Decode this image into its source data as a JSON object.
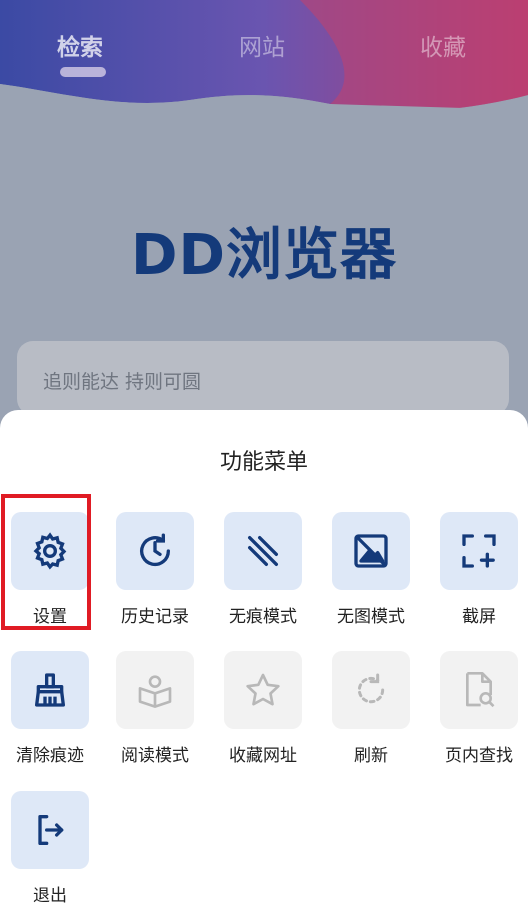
{
  "header": {
    "tabs": [
      {
        "label": "检索"
      },
      {
        "label": "网站"
      },
      {
        "label": "收藏"
      }
    ]
  },
  "main": {
    "title": "DD浏览器",
    "search_placeholder": "追则能达 持则可圆"
  },
  "menu": {
    "title": "功能菜单",
    "items": [
      {
        "label": "设置",
        "icon": "gear-icon",
        "enabled": true
      },
      {
        "label": "历史记录",
        "icon": "history-icon",
        "enabled": true
      },
      {
        "label": "无痕模式",
        "icon": "incognito-icon",
        "enabled": true
      },
      {
        "label": "无图模式",
        "icon": "no-image-icon",
        "enabled": true
      },
      {
        "label": "截屏",
        "icon": "screenshot-icon",
        "enabled": true
      },
      {
        "label": "清除痕迹",
        "icon": "broom-icon",
        "enabled": true
      },
      {
        "label": "阅读模式",
        "icon": "reader-icon",
        "enabled": false
      },
      {
        "label": "收藏网址",
        "icon": "star-icon",
        "enabled": false
      },
      {
        "label": "刷新",
        "icon": "refresh-icon",
        "enabled": false
      },
      {
        "label": "页内查找",
        "icon": "find-in-page-icon",
        "enabled": false
      },
      {
        "label": "退出",
        "icon": "exit-icon",
        "enabled": true
      }
    ]
  },
  "colors": {
    "accent": "#143a7a",
    "tile_enabled": "#dee8f7",
    "tile_disabled": "#f2f2f2",
    "highlight": "#e01b24"
  }
}
